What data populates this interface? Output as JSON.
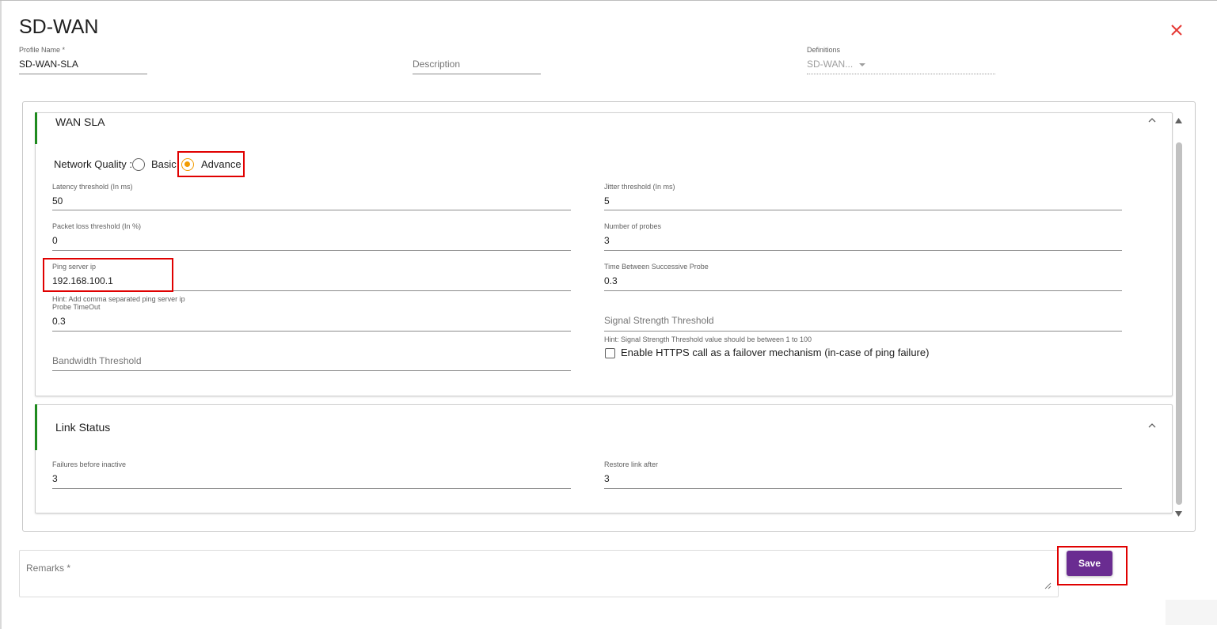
{
  "dialog": {
    "title": "SD-WAN"
  },
  "header": {
    "profile_name_label": "Profile Name *",
    "profile_name_value": "SD-WAN-SLA",
    "description_placeholder": "Description",
    "definitions_label": "Definitions",
    "definitions_value": "SD-WAN..."
  },
  "wan_sla": {
    "title": "WAN SLA",
    "network_quality_label": "Network Quality :",
    "options": [
      "Basic",
      "Advance"
    ],
    "selected": "Advance",
    "fields": {
      "latency_label": "Latency threshold (In ms)",
      "latency_value": "50",
      "jitter_label": "Jitter threshold (In ms)",
      "jitter_value": "5",
      "packet_loss_label": "Packet loss threshold (In %)",
      "packet_loss_value": "0",
      "probes_label": "Number of probes",
      "probes_value": "3",
      "ping_label": "Ping server ip",
      "ping_value": "192.168.100.1",
      "ping_hint": "Hint: Add comma separated ping server ip",
      "time_between_label": "Time Between Successive Probe",
      "time_between_value": "0.3",
      "probe_timeout_label": "Probe TimeOut",
      "probe_timeout_value": "0.3",
      "signal_placeholder": "Signal Strength Threshold",
      "signal_hint": "Hint: Signal Strength Threshold value should be between 1 to 100",
      "bandwidth_placeholder": "Bandwidth Threshold",
      "https_checkbox_label": "Enable HTTPS call as a failover mechanism (in-case of ping failure)",
      "https_checked": false
    }
  },
  "link_status": {
    "title": "Link Status",
    "failures_label": "Failures before inactive",
    "failures_value": "3",
    "restore_label": "Restore link after",
    "restore_value": "3"
  },
  "footer": {
    "remarks_placeholder": "Remarks *",
    "save_label": "Save"
  },
  "colors": {
    "accent_green": "#1e8a1e",
    "radio_orange": "#f29b00",
    "save_purple": "#6a2c91",
    "close_red": "#e53935",
    "highlight_red": "#e00000"
  }
}
